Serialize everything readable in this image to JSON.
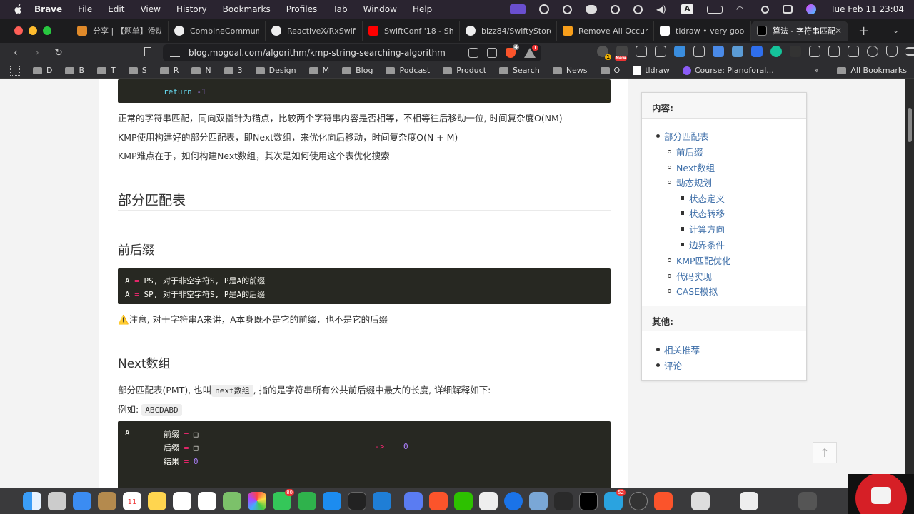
{
  "menubar": {
    "app": "Brave",
    "items": [
      "File",
      "Edit",
      "View",
      "History",
      "Bookmarks",
      "Profiles",
      "Tab",
      "Window",
      "Help"
    ],
    "clock": "Tue Feb 11  23:04",
    "status_icons": [
      "screen-share-icon",
      "creative-cloud-icon",
      "sync-icon",
      "wechat-icon",
      "play-icon",
      "play-circle-icon",
      "volume-icon",
      "input-a-icon",
      "battery-icon",
      "wifi-icon",
      "search-icon",
      "control-center-icon",
      "siri-icon"
    ],
    "input_letter": "A"
  },
  "tabs": [
    {
      "title": "分享 | 【题单】滑动窗",
      "icon": "share-favicon"
    },
    {
      "title": "CombineCommunity",
      "icon": "github-favicon"
    },
    {
      "title": "ReactiveX/RxSwift",
      "icon": "github-favicon"
    },
    {
      "title": "SwiftConf '18 - Sha",
      "icon": "youtube-favicon"
    },
    {
      "title": "bizz84/SwiftyStore",
      "icon": "github-favicon"
    },
    {
      "title": "Remove All Occurre",
      "icon": "leetcode-favicon"
    },
    {
      "title": "tldraw • very good",
      "icon": "tldraw-favicon"
    },
    {
      "title": "算法 - 字符串匹配",
      "icon": "site-favicon",
      "active": true
    }
  ],
  "toolbar": {
    "url": "blog.mogoal.com/algorithm/kmp-string-searching-algorithm",
    "brave_shield_badge": "4",
    "rewards_badge": "1",
    "ext_badge_a": "1",
    "ext_badge_new": "New"
  },
  "bookmarks": [
    "D",
    "B",
    "T",
    "S",
    "R",
    "N",
    "3",
    "Design",
    "M",
    "Blog",
    "Podcast",
    "Product",
    "Search",
    "News",
    "O"
  ],
  "bookmarks_extra": {
    "tldraw": "tldraw",
    "course": "Course: Pianoforal...",
    "all": "All Bookmarks",
    "more": "»"
  },
  "article": {
    "code0": {
      "kw": "return",
      "num": "-1"
    },
    "p1": "正常的字符串匹配，同向双指针为锚点，比较两个字符串内容是否相等，不相等往后移动一位, 时间复杂度O(NM)",
    "p2": "KMP使用构建好的部分匹配表，即Next数组，来优化向后移动，时间复杂度O(N + M)",
    "p3": "KMP难点在于，如何构建Next数组，其次是如何使用这个表优化搜索",
    "h2": "部分匹配表",
    "h3a": "前后缀",
    "code1": {
      "l1": {
        "a": "A",
        "eq": "=",
        "rest": "PS, 对于非空字符S, P是A的前缀"
      },
      "l2": {
        "a": "A",
        "eq": "=",
        "rest": "SP, 对于非空字符S, P是A的后缀"
      }
    },
    "warn_icon": "⚠️",
    "warn": "注意, 对于字符串A来讲，A本身既不是它的前缀，也不是它的后缀",
    "h3b": "Next数组",
    "p4_before": "部分匹配表(PMT), 也叫",
    "p4_code": "next数组",
    "p4_after": ", 指的是字符串所有公共前后缀中最大的长度, 详细解释如下:",
    "p5_label": "例如:",
    "p5_code": "ABCDABD",
    "code2": {
      "a": "A",
      "prefix_label": "前缀",
      "suffix_label": "后缀",
      "result_label": "结果",
      "eq": "=",
      "box": "□",
      "arrow": "->",
      "zero": "0",
      "result": "0"
    }
  },
  "toc": {
    "title": "内容:",
    "items": [
      {
        "label": "部分匹配表",
        "level": 1
      },
      {
        "label": "前后缀",
        "level": 2
      },
      {
        "label": "Next数组",
        "level": 2
      },
      {
        "label": "动态规划",
        "level": 2
      },
      {
        "label": "状态定义",
        "level": 3
      },
      {
        "label": "状态转移",
        "level": 3
      },
      {
        "label": "计算方向",
        "level": 3
      },
      {
        "label": "边界条件",
        "level": 3
      },
      {
        "label": "KMP匹配优化",
        "level": 2
      },
      {
        "label": "代码实现",
        "level": 2
      },
      {
        "label": "CASE模拟",
        "level": 2
      }
    ],
    "other_title": "其他:",
    "other_items": [
      "相关推荐",
      "评论"
    ]
  },
  "dock": {
    "badges": {
      "messages": "80",
      "telegram": "52"
    },
    "calendar_day": "11"
  },
  "colors": {
    "link": "#3d6ea8",
    "code_bg": "#272822",
    "code_keyword": "#66d9ef",
    "code_number": "#ae81ff",
    "code_operator": "#f92672"
  }
}
